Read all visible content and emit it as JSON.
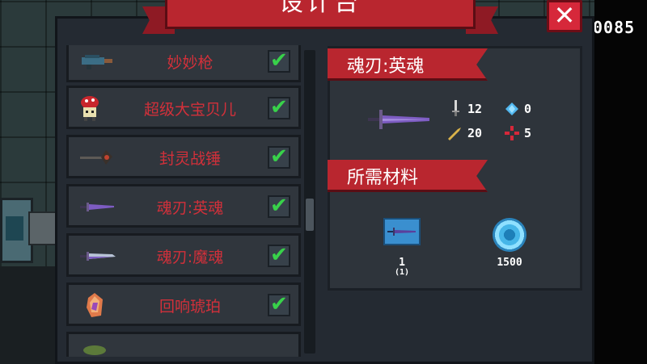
{
  "header": {
    "title": "设计台",
    "score": "0085"
  },
  "items": [
    {
      "name": "妙妙枪",
      "checked": "✔",
      "icon": "gun-icon"
    },
    {
      "name": "超级大宝贝儿",
      "checked": "✔",
      "icon": "mushroom-bomb-icon"
    },
    {
      "name": "封灵战锤",
      "checked": "✔",
      "icon": "hammer-icon"
    },
    {
      "name": "魂刃:英魂",
      "checked": "✔",
      "icon": "purple-sword-icon"
    },
    {
      "name": "魂刃:魔魂",
      "checked": "✔",
      "icon": "purple-blade-icon"
    },
    {
      "name": "回响琥珀",
      "checked": "✔",
      "icon": "amber-gem-icon"
    }
  ],
  "detail": {
    "name": "魂刃:英魂",
    "stats": {
      "damage": "12",
      "energy": "0",
      "crit": "20",
      "accuracy": "5"
    },
    "materials_title": "所需材料",
    "materials": [
      {
        "icon": "blueprint-icon",
        "count": "1",
        "owned": "(1)"
      },
      {
        "icon": "gem-currency-icon",
        "count": "1500"
      }
    ]
  },
  "close_symbol": "✕",
  "colors": {
    "accent_red": "#b9262f",
    "check_green": "#38d24a",
    "panel": "#242a32"
  }
}
